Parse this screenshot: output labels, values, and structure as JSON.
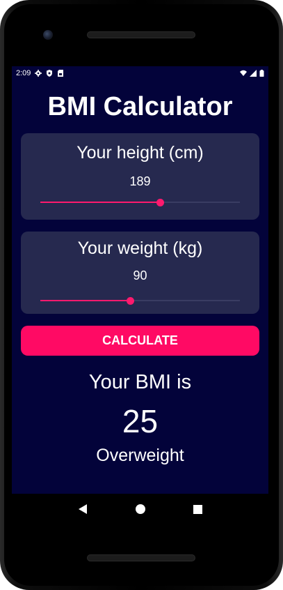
{
  "status_bar": {
    "time": "2:09"
  },
  "app": {
    "title": "BMI Calculator"
  },
  "height_card": {
    "label": "Your height (cm)",
    "value": "189",
    "slider_fraction": 0.6
  },
  "weight_card": {
    "label": "Your weight (kg)",
    "value": "90",
    "slider_fraction": 0.45
  },
  "calculate_button": {
    "label": "CALCULATE"
  },
  "result": {
    "title": "Your BMI is",
    "value": "25",
    "category": "Overweight"
  },
  "colors": {
    "background": "#03033a",
    "card": "#26294f",
    "accent": "#ff0a64"
  },
  "icons": {
    "status_left": [
      "settings-icon",
      "shield-icon",
      "sim-card-icon"
    ],
    "status_right": [
      "wifi-icon",
      "signal-icon",
      "battery-icon"
    ],
    "nav": [
      "back-icon",
      "home-icon",
      "recents-icon"
    ]
  }
}
